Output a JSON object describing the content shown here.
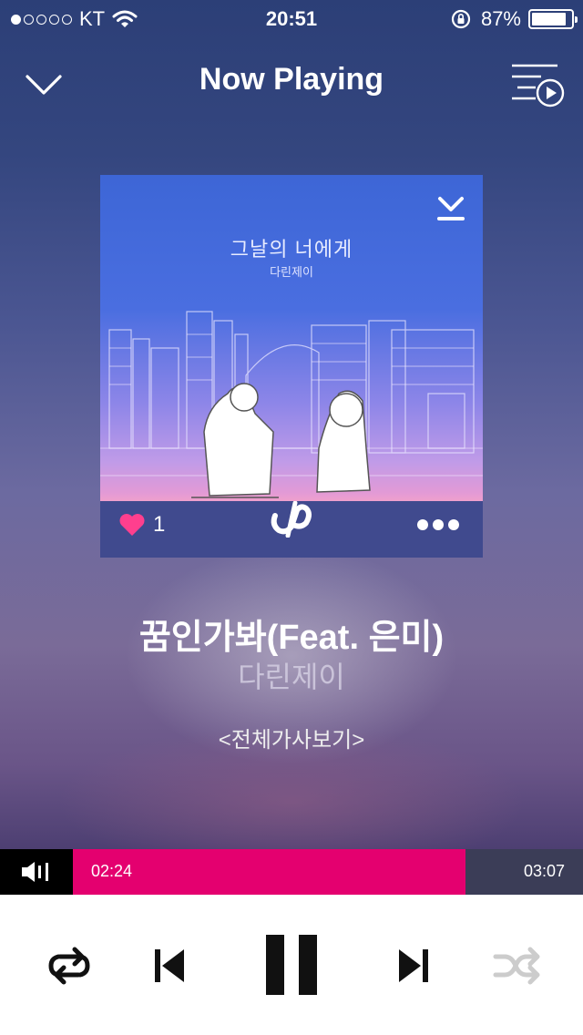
{
  "status_bar": {
    "signal_dots_filled": 1,
    "signal_dots_total": 5,
    "carrier": "KT",
    "time": "20:51",
    "battery_percent": "87%",
    "battery_level": 0.87
  },
  "nav": {
    "title": "Now Playing",
    "collapse_icon": "chevron-down-icon",
    "playlist_icon": "playlist-play-icon"
  },
  "album": {
    "title": "그날의 너에게",
    "artist": "다린제이",
    "like_count": "1",
    "like_icon": "heart-icon",
    "download_icon": "download-icon",
    "more_icon": "more-dots-icon",
    "logo_icon": "service-logo-icon"
  },
  "song": {
    "title": "꿈인가봐(Feat. 은미)",
    "artist": "다린제이",
    "lyrics_link": "<전체가사보기>"
  },
  "progress": {
    "elapsed": "02:24",
    "total": "03:07",
    "fraction": 0.77,
    "volume_icon": "volume-icon"
  },
  "controls": {
    "repeat_icon": "repeat-icon",
    "previous_icon": "skip-previous-icon",
    "pause_icon": "pause-icon",
    "next_icon": "skip-next-icon",
    "shuffle_icon": "shuffle-icon"
  },
  "colors": {
    "accent": "#e4006f",
    "heart": "#ff3f8e",
    "shuffle_inactive": "#cccccc"
  }
}
